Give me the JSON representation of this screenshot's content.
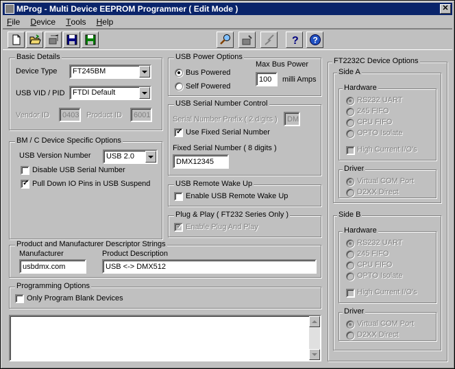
{
  "window": {
    "title": "MProg - Multi Device EEPROM Programmer ( Edit Mode )",
    "close_label": "✕"
  },
  "menu": [
    {
      "prefix": "",
      "underline": "F",
      "rest": "ile"
    },
    {
      "prefix": "",
      "underline": "D",
      "rest": "evice"
    },
    {
      "prefix": "",
      "underline": "T",
      "rest": "ools"
    },
    {
      "prefix": "",
      "underline": "H",
      "rest": "elp"
    }
  ],
  "toolbar": [
    "new-file-icon",
    "open-folder-icon",
    "erase-icon",
    "save-icon",
    "save-as-icon",
    "search-icon",
    "program-icon",
    "flash-icon",
    "help-icon",
    "about-icon"
  ],
  "basic": {
    "legend": "Basic Details",
    "device_type_label": "Device Type",
    "device_type": "FT245BM",
    "vidpid_label": "USB VID / PID",
    "vidpid": "FTDI Default",
    "vendor_label": "Vendor ID",
    "vendor_id": "0403",
    "product_label": "Product ID",
    "product_id": "6001"
  },
  "bmc": {
    "legend": "BM / C Device Specific Options",
    "usb_version_label": "USB Version Number",
    "usb_version": "USB 2.0",
    "disable_serial": "Disable USB Serial Number",
    "pull_down": "Pull Down IO Pins in USB Suspend"
  },
  "power": {
    "legend": "USB Power Options",
    "bus_powered": "Bus Powered",
    "self_powered": "Self Powered",
    "max_label": "Max Bus Power",
    "max_value": "100",
    "unit": "milli Amps"
  },
  "serial": {
    "legend": "USB Serial Number Control",
    "prefix_label": "Serial Number Prefix ( 2 digits )",
    "prefix": "DM",
    "use_fixed": "Use Fixed Serial Number",
    "fixed_label": "Fixed Serial Number ( 8 digits )",
    "fixed": "DMX12345"
  },
  "wake": {
    "legend": "USB Remote Wake Up",
    "enable": "Enable USB Remote Wake Up"
  },
  "pnp": {
    "legend": "Plug & Play  ( FT232 Series Only )",
    "enable": "Enable Plug And Play"
  },
  "strings": {
    "legend": "Product and Manufacturer Descriptor Strings",
    "manufacturer_label": "Manufacturer",
    "manufacturer": "usbdmx.com",
    "product_label": "Product Description",
    "product": "USB <-> DMX512"
  },
  "programming": {
    "legend": "Programming Options",
    "only_blank": "Only Program Blank Devices"
  },
  "ft2232c": {
    "legend": "FT2232C Device Options",
    "side_a": "Side A",
    "side_b": "Side B",
    "hardware": "Hardware",
    "driver": "Driver",
    "hw_options": [
      "RS232 UART",
      "245 FIFO",
      "CPU FIFO",
      "OPTO Isolate"
    ],
    "high_current": "High Current I/O's",
    "drv_options": [
      "Virtual COM Port",
      "D2XX Direct"
    ]
  }
}
